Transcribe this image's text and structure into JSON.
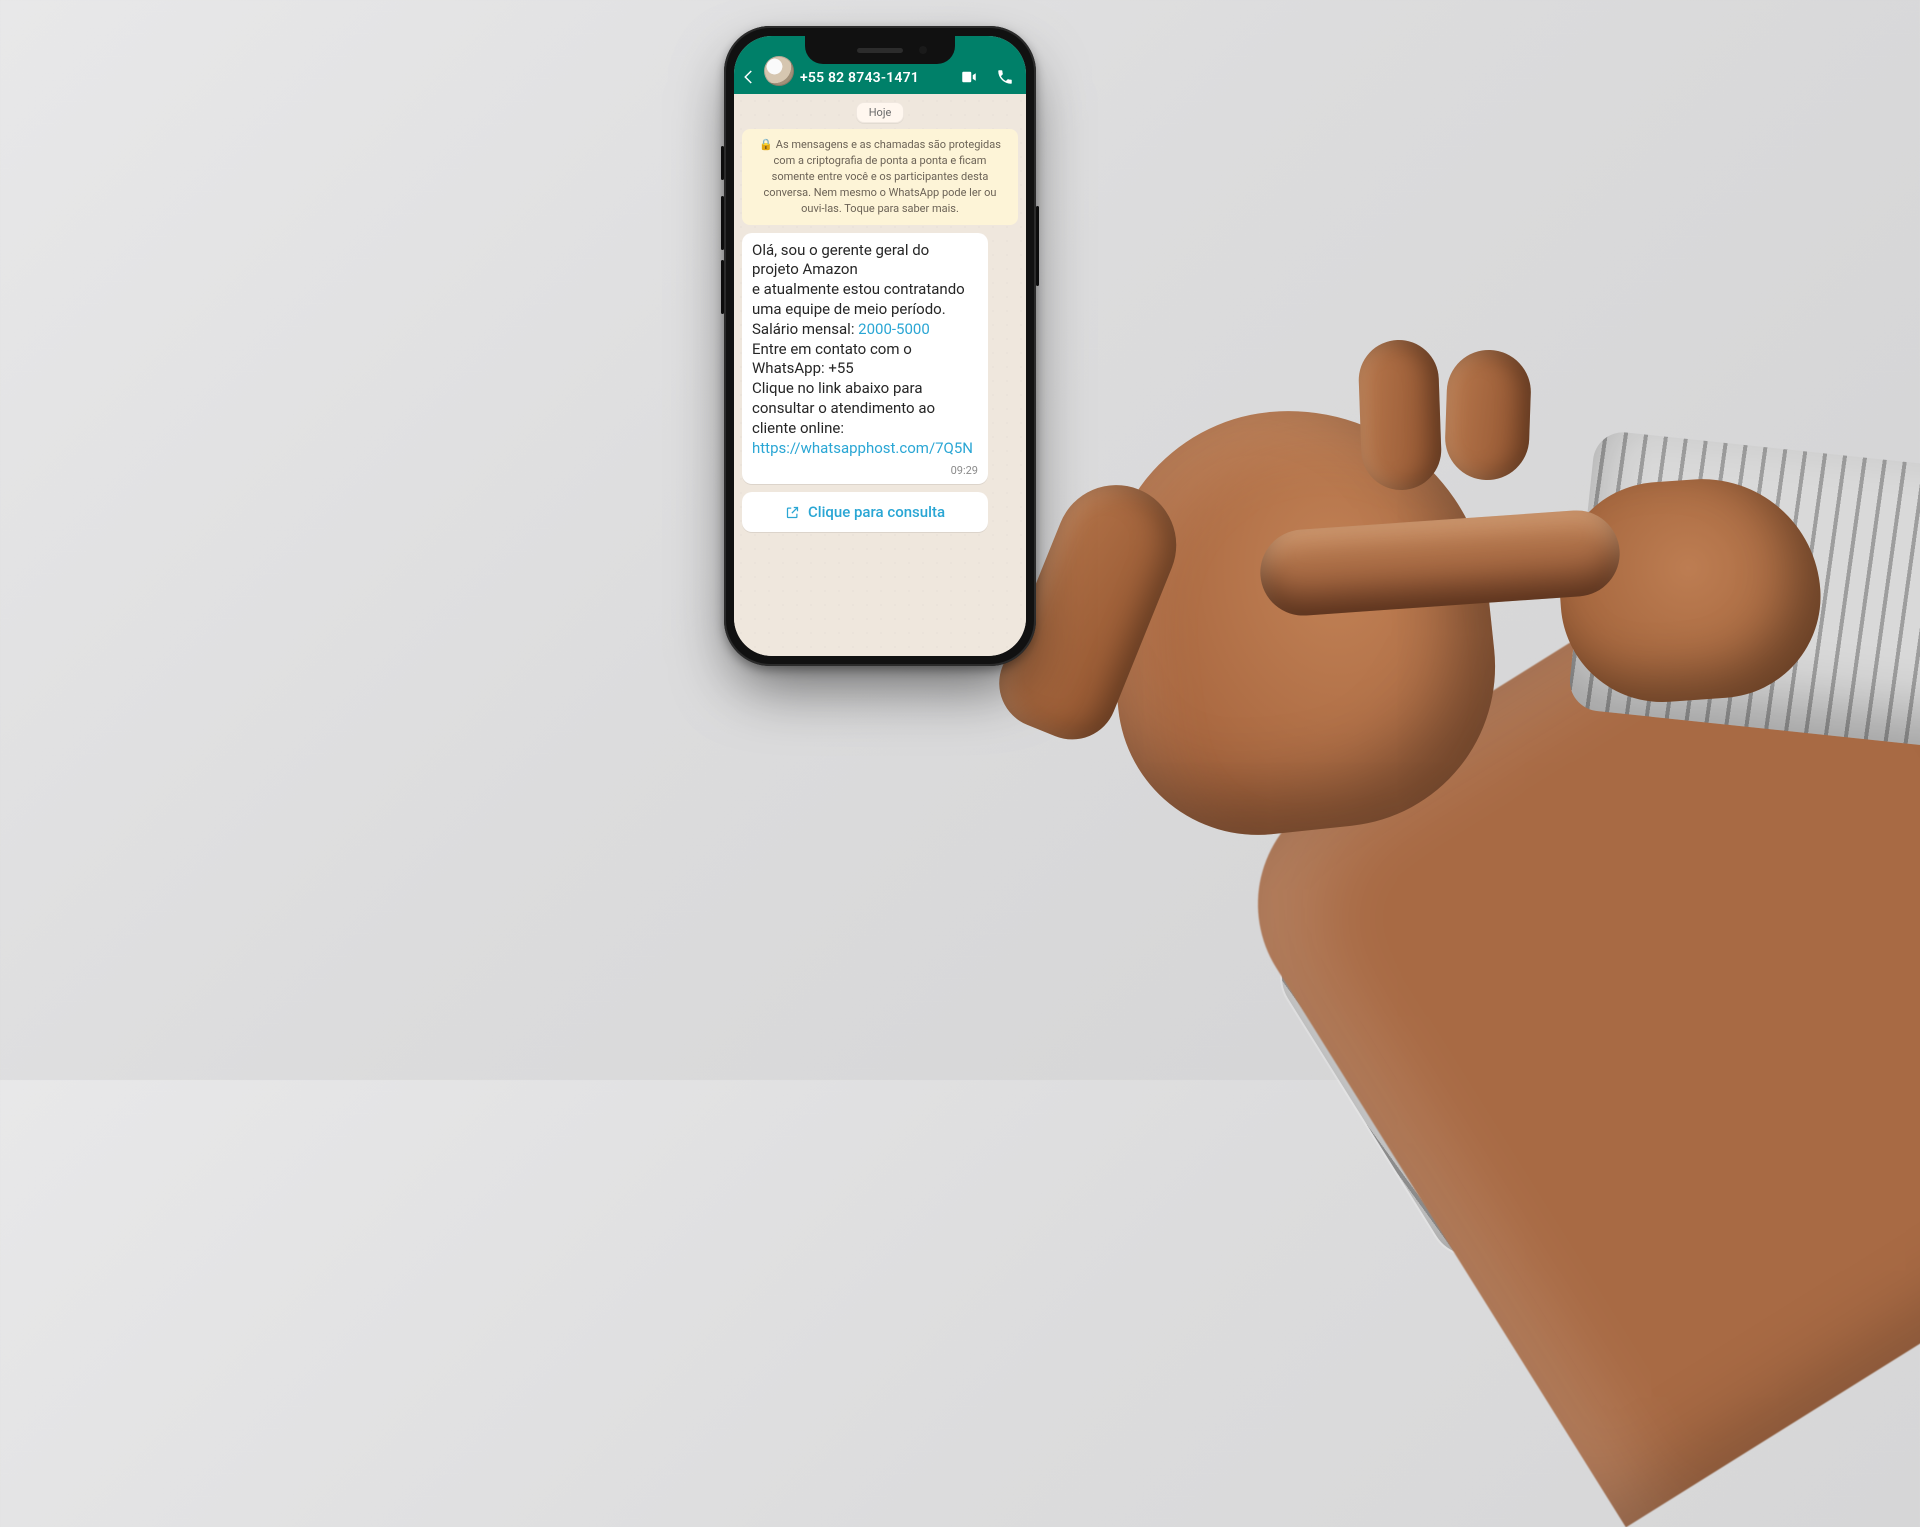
{
  "header": {
    "phone_number": "+55 82 8743-1471"
  },
  "chat": {
    "date_label": "Hoje",
    "e2e_notice": "As mensagens e as chamadas são protegidas com a criptografia de ponta a ponta e ficam somente entre você e os participantes desta conversa. Nem mesmo o WhatsApp pode ler ou ouvi-las. Toque para saber mais.",
    "message": {
      "line1": "Olá, sou o gerente geral do projeto Amazon",
      "line2": "e atualmente estou contratando uma equipe de meio período.",
      "salary_label": "Salário mensal: ",
      "salary_link": "2000-5000",
      "contact_line": "Entre em contato com o WhatsApp: +55",
      "link_intro": "Clique no link abaixo para consultar o atendimento ao cliente online: ",
      "url": "https://whatsapphost.com/7Q5N",
      "time": "09:29"
    },
    "cta_label": "Clique para consulta"
  }
}
